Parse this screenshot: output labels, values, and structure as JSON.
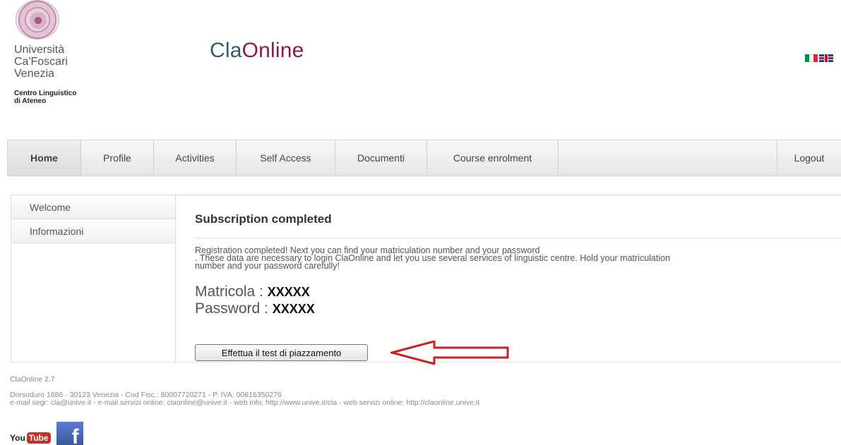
{
  "header": {
    "university_lines": [
      "Università",
      "Ca'Foscari",
      "Venezia"
    ],
    "centro_lines": [
      "Centro Linguistico",
      "di Ateneo"
    ],
    "brand_part1": "Cla",
    "brand_part2": "Online"
  },
  "nav": {
    "items": [
      {
        "label": "Home",
        "active": true
      },
      {
        "label": "Profile"
      },
      {
        "label": "Activities"
      },
      {
        "label": "Self Access"
      },
      {
        "label": "Documenti"
      },
      {
        "label": "Course enrolment"
      }
    ],
    "logout": "Logout"
  },
  "sidebar": {
    "items": [
      {
        "label": "Welcome"
      },
      {
        "label": "Informazioni"
      }
    ]
  },
  "content": {
    "title": "Subscription completed",
    "message_lines": [
      "Registration completed! Next you can find your matriculation number and your password",
      ". These data are necessary to login ClaOnline and let you use several services of linguistic centre. Hold your matriculation",
      "number and your password carefully!"
    ],
    "matricola_label": "Matricola :",
    "matricola_value": "XXXXX",
    "password_label": "Password :",
    "password_value": "XXXXX",
    "button_label": "Effettua il test di piazzamento"
  },
  "footer": {
    "version": "ClaOnline 2.7",
    "address_line1": "Dorsoduro 1686 - 30123 Venezia - Cod Fisc.: 80007720271 - P. IVA: 00816350276",
    "address_line2": "e-mail segr: cla@unive.it - e-mail servizi online: claonline@unive.it - web info: http://www.unive.it/cla - web servizi online: http://claonline.unive.it",
    "youtube_you": "You",
    "youtube_tube": "Tube",
    "facebook_letter": "f"
  },
  "colors": {
    "brand_cla": "#2c5d6e",
    "brand_online": "#8e1b4e",
    "arrow": "#cc1f1f",
    "flag_it": [
      "#009246",
      "#ffffff",
      "#ce2b37"
    ]
  }
}
